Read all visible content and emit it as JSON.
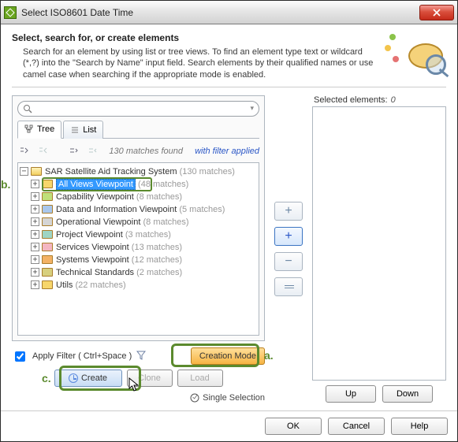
{
  "window": {
    "title": "Select ISO8601 Date Time"
  },
  "header": {
    "title": "Select, search for, or create elements",
    "desc": "Search for an element by using list or tree views. To find an element type text or wildcard (*,?) into the \"Search by Name\" input field. Search elements by their qualified names or use camel case when searching if the appropriate mode is enabled."
  },
  "search": {
    "value": "",
    "placeholder": ""
  },
  "tabs": {
    "tree": "Tree",
    "list": "List"
  },
  "matches": {
    "count": "130 matches found",
    "link": "with filter applied"
  },
  "tree": {
    "root": {
      "label": "SAR Satellite Aid Tracking System",
      "count": "(130 matches)"
    },
    "items": [
      {
        "label": "All Views Viewpoint",
        "count": "(48 matches)",
        "folder": "f-yellow",
        "selected": true
      },
      {
        "label": "Capability Viewpoint",
        "count": "(8 matches)",
        "folder": "f-green"
      },
      {
        "label": "Data and Information Viewpoint",
        "count": "(5 matches)",
        "folder": "f-blue"
      },
      {
        "label": "Operational Viewpoint",
        "count": "(8 matches)",
        "folder": "f-grey"
      },
      {
        "label": "Project Viewpoint",
        "count": "(3 matches)",
        "folder": "f-teal"
      },
      {
        "label": "Services Viewpoint",
        "count": "(13 matches)",
        "folder": "f-pink"
      },
      {
        "label": "Systems Viewpoint",
        "count": "(12 matches)",
        "folder": "f-orange"
      },
      {
        "label": "Technical Standards",
        "count": "(2 matches)",
        "folder": "f-olive"
      },
      {
        "label": "Utils",
        "count": "(22 matches)",
        "folder": "f-yellow"
      }
    ]
  },
  "filter": {
    "apply_label": "Apply Filter ( Ctrl+Space )"
  },
  "buttons": {
    "creation_mode": "Creation Mode",
    "create": "Create",
    "clone": "Clone",
    "load": "Load",
    "single_selection": "Single Selection",
    "up": "Up",
    "down": "Down",
    "ok": "OK",
    "cancel": "Cancel",
    "help": "Help"
  },
  "selected": {
    "label": "Selected elements:",
    "count": "0"
  },
  "annot": {
    "a": "a.",
    "b": "b.",
    "c": "c."
  }
}
